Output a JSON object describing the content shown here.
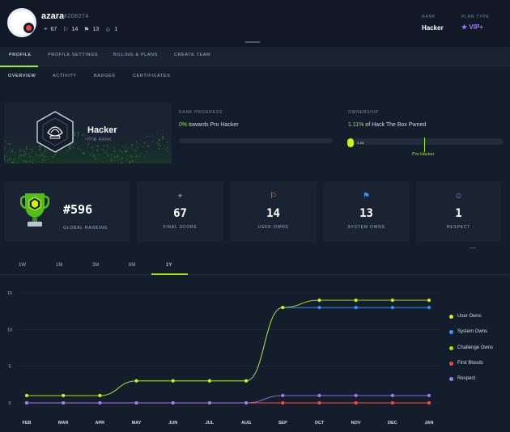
{
  "header": {
    "username": "azara",
    "user_id": "#208274",
    "stats": {
      "score": "67",
      "user_owns": "14",
      "system_owns": "13",
      "respect": "1"
    },
    "rank_label": "RANK",
    "rank_value": "Hacker",
    "plan_label": "PLAN TYPE",
    "plan_value": "VIP+",
    "colors": {
      "background": "#111927",
      "accent": "#9fef00",
      "vip": "#a17aff",
      "avatar_status": "#ff3e3e"
    }
  },
  "tabs_primary": [
    {
      "label": "PROFILE",
      "active": true
    },
    {
      "label": "PROFILE SETTINGS",
      "active": false
    },
    {
      "label": "BILLING & PLANS",
      "active": false
    },
    {
      "label": "CREATE TEAM",
      "active": false
    }
  ],
  "tabs_secondary": [
    {
      "label": "OVERVIEW",
      "active": true
    },
    {
      "label": "ACTIVITY",
      "active": false
    },
    {
      "label": "BADGES",
      "active": false
    },
    {
      "label": "CERTIFICATES",
      "active": false
    }
  ],
  "rank_card": {
    "title": "Hacker",
    "subtitle": "HTB RANK"
  },
  "rank_progress": {
    "label": "RANK PROGRESS",
    "percent": "0%",
    "text": "towards Pro Hacker",
    "progress_fraction": 0.0
  },
  "ownership": {
    "label": "OWNERSHIP",
    "percent": "1.11%",
    "text": "of Hack The Box Pwned",
    "current_value": "1.11",
    "target_label": "Pro Hacker"
  },
  "stat_cards": {
    "global": {
      "value": "#596",
      "label": "GLOBAL RANKING"
    },
    "items": [
      {
        "icon": "target-icon",
        "icon_color": "#a4b1cd",
        "value": "67",
        "label": "FINAL SCORE"
      },
      {
        "icon": "user-flag-icon",
        "icon_color": "#ffaf00",
        "value": "14",
        "label": "USER OWNS"
      },
      {
        "icon": "system-flag-icon",
        "icon_color": "#2e9bff",
        "value": "13",
        "label": "SYSTEM OWNS"
      },
      {
        "icon": "smiley-icon",
        "icon_color": "#a17aff",
        "value": "1",
        "label": "RESPECT"
      }
    ]
  },
  "time_ranges": [
    {
      "label": "1W",
      "active": false
    },
    {
      "label": "1M",
      "active": false
    },
    {
      "label": "3M",
      "active": false
    },
    {
      "label": "6M",
      "active": false
    },
    {
      "label": "1Y",
      "active": true
    }
  ],
  "chart_data": {
    "type": "line",
    "title": "",
    "xlabel": "",
    "ylabel": "",
    "x": [
      "FEB",
      "MAR",
      "APR",
      "MAY",
      "JUN",
      "JUL",
      "AUG",
      "SEP",
      "OCT",
      "NOV",
      "DEC",
      "JAN"
    ],
    "yticks": [
      0,
      5,
      10,
      15
    ],
    "ylim": [
      0,
      15
    ],
    "grid": true,
    "legend": "right",
    "series": [
      {
        "name": "User Owns",
        "color": "#cff600",
        "values": [
          1,
          1,
          1,
          3,
          3,
          3,
          3,
          13,
          14,
          14,
          14,
          14
        ]
      },
      {
        "name": "System Owns",
        "color": "#2e9bff",
        "values": [
          1,
          1,
          1,
          3,
          3,
          3,
          3,
          13,
          13,
          13,
          13,
          13
        ]
      },
      {
        "name": "Challenge Owns",
        "color": "#9fef00",
        "values": [
          0,
          0,
          0,
          0,
          0,
          0,
          0,
          0,
          0,
          0,
          0,
          0
        ]
      },
      {
        "name": "First Bloods",
        "color": "#ff3e3e",
        "values": [
          0,
          0,
          0,
          0,
          0,
          0,
          0,
          0,
          0,
          0,
          0,
          0
        ]
      },
      {
        "name": "Respect",
        "color": "#a17aff",
        "values": [
          0,
          0,
          0,
          0,
          0,
          0,
          0,
          1,
          1,
          1,
          1,
          1
        ]
      }
    ]
  }
}
